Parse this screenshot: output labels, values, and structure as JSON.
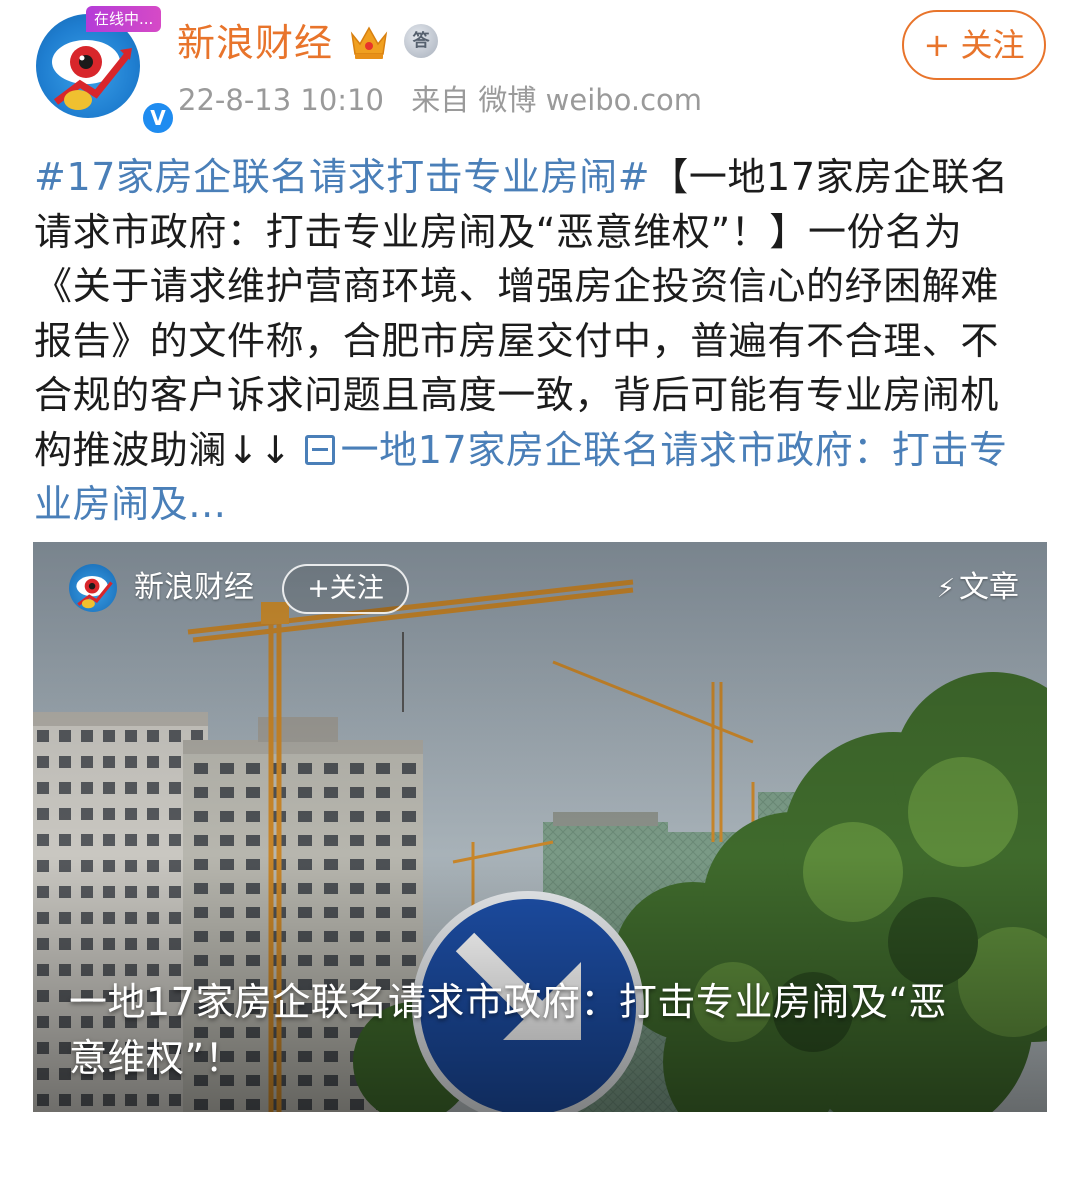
{
  "author": {
    "name": "新浪财经",
    "online_tag": "在线中...",
    "verified_mark": "V",
    "medal_text": "答"
  },
  "meta": {
    "time": "22-8-13 10:10",
    "source": "来自 微博 weibo.com"
  },
  "follow_label": "+ 关注",
  "post": {
    "hashtag": "#17家房企联名请求打击专业房闹#",
    "body": "【一地17家房企联名请求市政府：打击专业房闹及“恶意维权”！】一份名为《关于请求维护营商环境、增强房企投资信心的纾困解难报告》的文件称，合肥市房屋交付中，普遍有不合理、不合规的客户诉求问题且高度一致，背后可能有专业房闹机构推波助澜↓↓ ",
    "link_text": "一地17家房企联名请求市政府：打击专业房闹及..."
  },
  "card": {
    "author": "新浪财经",
    "follow_label": "+关注",
    "type_label": "文章",
    "title": "一地17家房企联名请求市政府：打击专业房闹及“恶意维权”！"
  },
  "colors": {
    "accent_orange": "#e8742b",
    "link_blue": "#4a7fb8",
    "meta_gray": "#9a9a9a"
  }
}
